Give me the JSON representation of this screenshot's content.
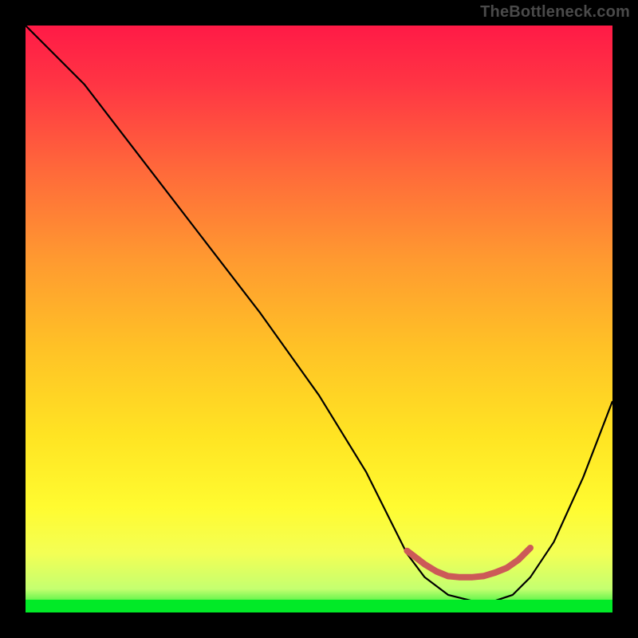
{
  "watermark": "TheBottleneck.com",
  "gradient": {
    "colors": [
      {
        "offset": 0.0,
        "hex": "#ff1a46"
      },
      {
        "offset": 0.1,
        "hex": "#ff3544"
      },
      {
        "offset": 0.25,
        "hex": "#ff6a3a"
      },
      {
        "offset": 0.4,
        "hex": "#ff9a30"
      },
      {
        "offset": 0.55,
        "hex": "#ffc226"
      },
      {
        "offset": 0.7,
        "hex": "#ffe423"
      },
      {
        "offset": 0.82,
        "hex": "#fffb30"
      },
      {
        "offset": 0.9,
        "hex": "#f3ff55"
      },
      {
        "offset": 0.96,
        "hex": "#c4ff70"
      },
      {
        "offset": 1.0,
        "hex": "#01ea27"
      }
    ]
  },
  "chart_data": {
    "type": "line",
    "title": "",
    "xlabel": "",
    "ylabel": "",
    "xlim": [
      0,
      100
    ],
    "ylim": [
      0,
      100
    ],
    "series": [
      {
        "name": "bottleneck-curve",
        "x": [
          0,
          4,
          10,
          20,
          30,
          40,
          50,
          58,
          62,
          65,
          68,
          72,
          76,
          80,
          83,
          86,
          90,
          95,
          100
        ],
        "y": [
          100,
          96,
          90,
          77,
          64,
          51,
          37,
          24,
          16,
          10,
          6,
          3,
          2,
          2,
          3,
          6,
          12,
          23,
          36
        ]
      },
      {
        "name": "optimal-band",
        "x": [
          65,
          68,
          70,
          72,
          74,
          76,
          78,
          80,
          82,
          84,
          86
        ],
        "y": [
          10.5,
          8.2,
          7.0,
          6.2,
          6.0,
          6.0,
          6.2,
          6.8,
          7.6,
          9.0,
          11.0
        ]
      }
    ],
    "annotations": []
  },
  "colors": {
    "curve": "#000000",
    "band": "#cc5a58",
    "frame": "#000000"
  }
}
